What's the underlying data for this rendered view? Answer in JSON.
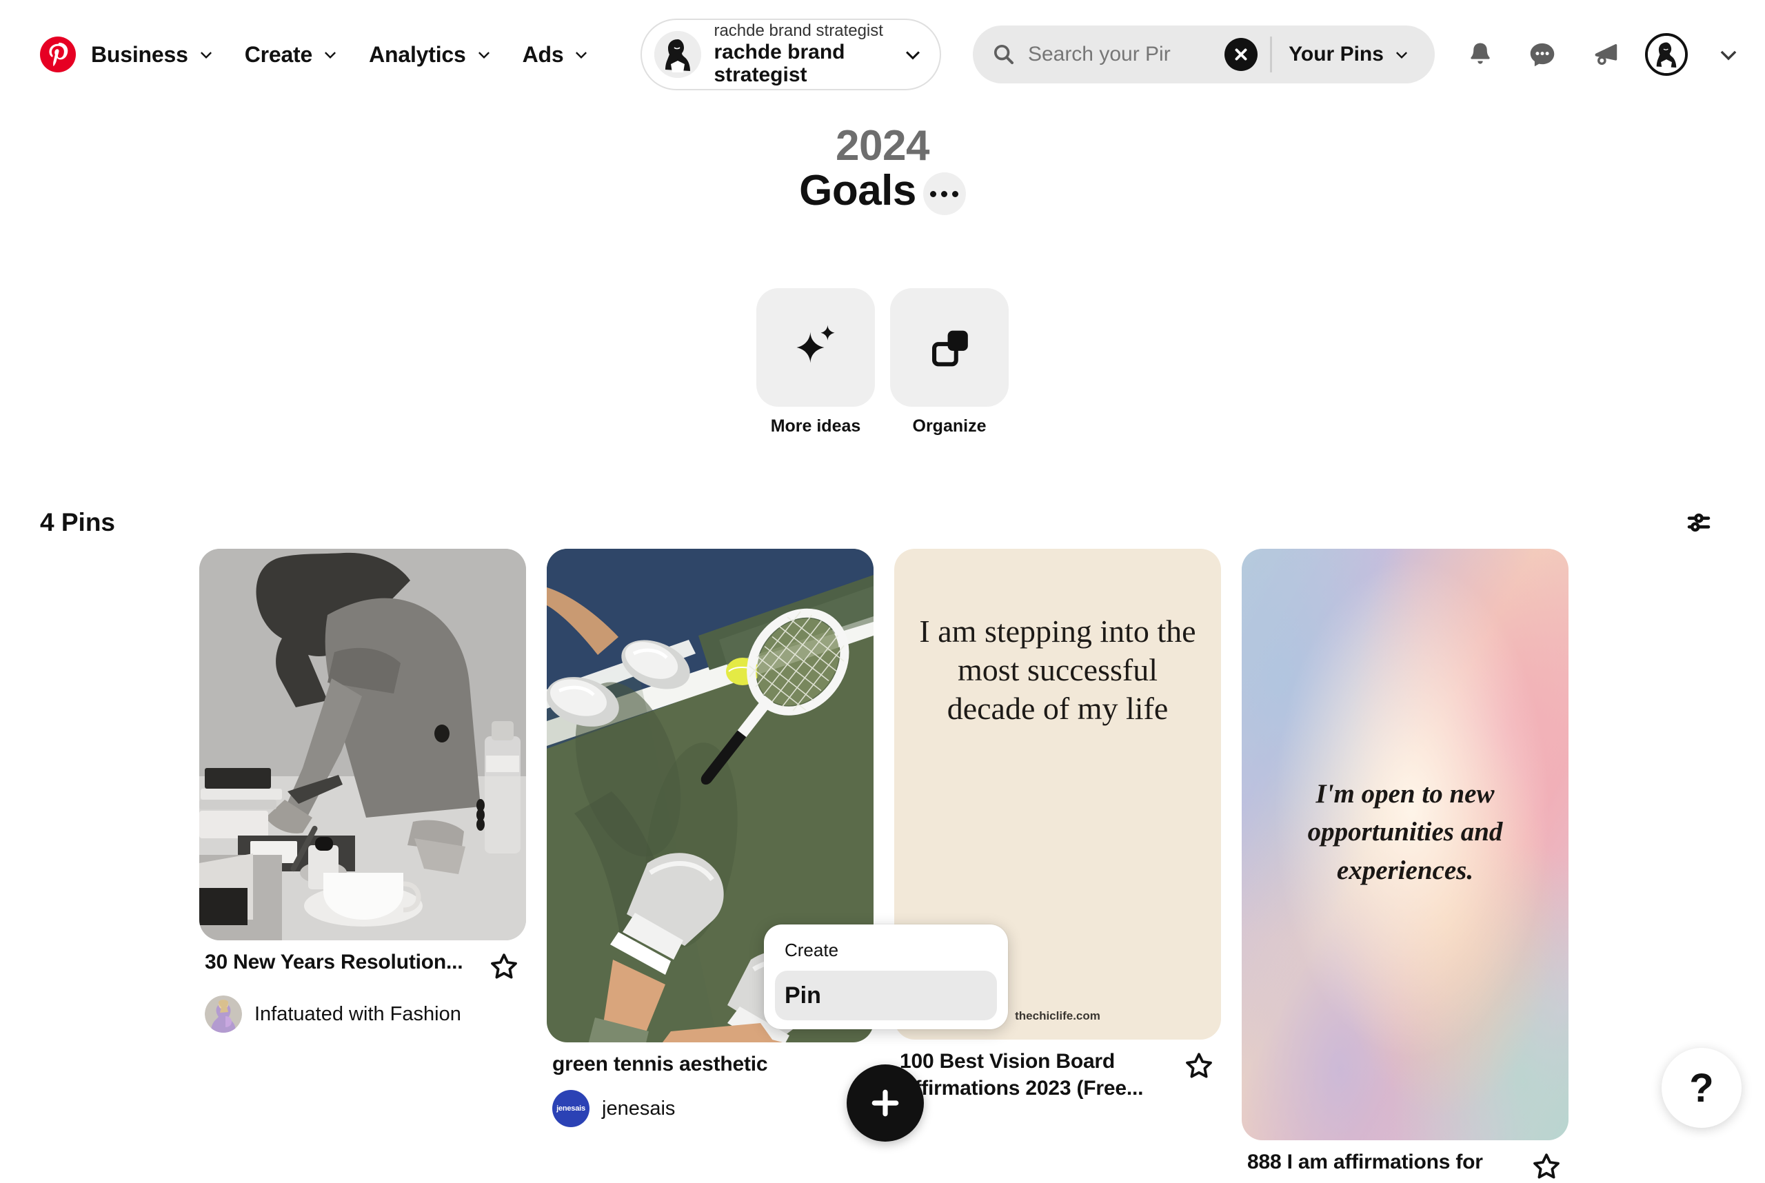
{
  "header": {
    "logo_icon": "pinterest-logo-icon",
    "nav": [
      {
        "label": "Business",
        "icon": "chevron-down-icon"
      },
      {
        "label": "Create",
        "icon": "chevron-down-icon"
      },
      {
        "label": "Analytics",
        "icon": "chevron-down-icon"
      },
      {
        "label": "Ads",
        "icon": "chevron-down-icon"
      }
    ],
    "account": {
      "sub_label": "rachde brand strategist",
      "name": "rachde brand strategist",
      "avatar_icon": "account-avatar-icon",
      "chevron_icon": "chevron-down-icon"
    },
    "search": {
      "icon": "search-icon",
      "placeholder": "Search your Pir",
      "value": "",
      "clear_icon": "clear-x-icon",
      "scope_label": "Your Pins",
      "scope_chevron_icon": "chevron-down-icon"
    },
    "right_icons": [
      {
        "name": "notifications-bell-icon"
      },
      {
        "name": "messages-chat-icon"
      },
      {
        "name": "announcements-megaphone-icon"
      }
    ],
    "profile_avatar_icon": "profile-avatar-icon",
    "profile_chevron_icon": "chevron-down-icon"
  },
  "board": {
    "year": "2024",
    "name": "Goals",
    "more_options_icon": "ellipsis-icon",
    "actions": [
      {
        "label": "More ideas",
        "icon": "sparkle-icon"
      },
      {
        "label": "Organize",
        "icon": "organize-squares-icon"
      }
    ]
  },
  "pins_bar": {
    "count_label": "4 Pins",
    "filter_icon": "filter-sliders-icon"
  },
  "pins": [
    {
      "title": "30 New Years Resolution...",
      "author": "Infatuated with Fashion",
      "save_icon": "star-outline-icon",
      "image_kind": "bw-photo-woman-desk",
      "image_text": "",
      "watermark": ""
    },
    {
      "title": "green tennis aesthetic",
      "author": "jenesais",
      "author_badge": "jenesais",
      "save_icon": "star-outline-icon",
      "image_kind": "tennis-court-photo",
      "image_text": "",
      "watermark": ""
    },
    {
      "title": "100 Best Vision Board Affirmations 2023 (Free...",
      "author": "",
      "save_icon": "star-outline-icon",
      "image_kind": "cream-affirmation-card",
      "image_text": "I am stepping into the most successful decade of my life",
      "watermark": "thechiclife.com"
    },
    {
      "title": "888 I am affirmations for",
      "author": "",
      "save_icon": "star-outline-icon",
      "image_kind": "pastel-gradient-card",
      "image_text": "I'm open to new opportunities and experiences.",
      "watermark": ""
    }
  ],
  "create_popup": {
    "label": "Create",
    "items": [
      {
        "label": "Pin",
        "selected": true
      }
    ]
  },
  "fab": {
    "icon": "plus-icon",
    "label": ""
  },
  "help": {
    "label": "?",
    "icon": "question-mark-icon"
  },
  "colors": {
    "brand_red": "#e60023",
    "text_primary": "#111111",
    "text_secondary": "#6e6e6e",
    "surface_gray": "#efefef",
    "search_gray": "#e9e9e9",
    "cream": "#f2e8d8",
    "jenesais_blue": "#2b42b5"
  }
}
